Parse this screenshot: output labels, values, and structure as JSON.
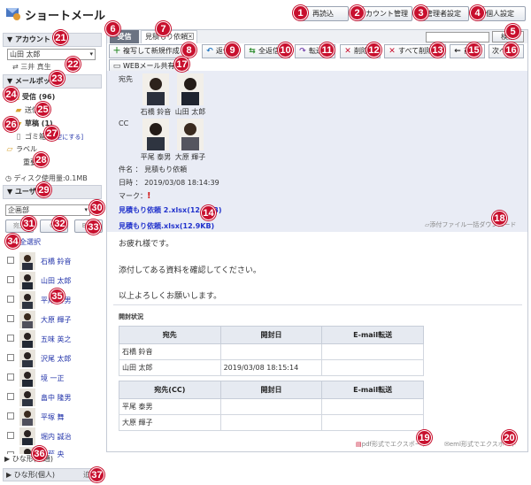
{
  "app": {
    "title": "ショートメール"
  },
  "topbar": {
    "reread": "再読込",
    "account_mgmt": "アカウント管理",
    "admin_settings": "管理者設定",
    "personal_settings": "個人設定"
  },
  "sidebar": {
    "account_header": "▼ アカウント",
    "account_selected": "山田 太郎",
    "account_sub": "三井 真生",
    "mailbox_header": "▼ メールボックス",
    "folders": [
      {
        "label": "受信 (96)"
      },
      {
        "label": "送信"
      },
      {
        "label": "草稿 (1)"
      },
      {
        "label": "ゴミ箱"
      },
      {
        "label": "ラベル"
      },
      {
        "label": "重要"
      }
    ],
    "trash_empty": "[空にする]",
    "disk_usage": "ディスク使用量:0.1MB",
    "user_header": "▼ ユーザ情報",
    "dept_selected": "企画部",
    "to_btn": "宛先",
    "cc_btn": "CC",
    "bcc_btn": "BCC",
    "select_all": "全選択",
    "users": [
      "石橋 鈴音",
      "山田 太郎",
      "平尾 泰男",
      "大原 輝子",
      "五味 英之",
      "沢尾 太郎",
      "境 一正",
      "畠中 隆男",
      "平塚 舞",
      "堀内 誠治",
      "遠藤 央"
    ],
    "footer_item1": "▶ ひな形(共通)",
    "footer_item2": "▶ ひな形(個人)",
    "footer_add": "追加"
  },
  "tabs": {
    "first_label": "受信",
    "open_label": "見積もり依頼"
  },
  "search": {
    "button": "検索",
    "placeholder": ""
  },
  "actions": {
    "reply_new": "複写して新規作成",
    "reply": "返信",
    "reply_all": "全返信",
    "forward": "転送",
    "delete": "削除",
    "delete_all": "すべて削除",
    "prev": "前へ",
    "next": "次へ",
    "web_share": "WEBメール共有"
  },
  "mail": {
    "to_label": "宛先",
    "to": [
      "石橋 鈴音",
      "山田 太郎"
    ],
    "cc_label": "CC",
    "cc": [
      "平尾 泰男",
      "大原 輝子"
    ],
    "subject": "件名 ： 見積もり依頼",
    "date": "日時 ： 2019/03/08 18:14:39",
    "mark": "マーク：",
    "attachments": [
      "見積もり依頼 2.xlsx(12.9KB)",
      "見積もり依頼.xlsx(12.9KB)"
    ],
    "download_all": "添付ファイル一括ダウンロード",
    "body": [
      "お疲れ様です。",
      "添付してある資料を確認してください。",
      "以上よろしくお願いします。"
    ],
    "open_status": "開封状況",
    "table1": {
      "headers": [
        "宛先",
        "開封日",
        "E-mail転送"
      ],
      "rows": [
        [
          "石橋 鈴音",
          "",
          ""
        ],
        [
          "山田 太郎",
          "2019/03/08 18:15:14",
          ""
        ]
      ]
    },
    "table2": {
      "headers": [
        "宛先(CC)",
        "開封日",
        "E-mail転送"
      ],
      "rows": [
        [
          "平尾 泰男",
          "",
          ""
        ],
        [
          "大原 輝子",
          "",
          ""
        ]
      ]
    },
    "export_pdf": "pdf形式でエクスポート",
    "export_eml": "eml形式でエクスポート"
  },
  "callouts": [
    "1",
    "2",
    "3",
    "4",
    "5",
    "6",
    "7",
    "8",
    "9",
    "10",
    "11",
    "12",
    "13",
    "14",
    "15",
    "16",
    "17",
    "18",
    "19",
    "20",
    "21",
    "22",
    "23",
    "24",
    "25",
    "26",
    "27",
    "28",
    "29",
    "30",
    "31",
    "32",
    "33",
    "34",
    "35",
    "36",
    "37"
  ],
  "colors": {
    "accent": "#c8102e",
    "link": "#2233aa",
    "header_bg": "#e5e8ee"
  }
}
